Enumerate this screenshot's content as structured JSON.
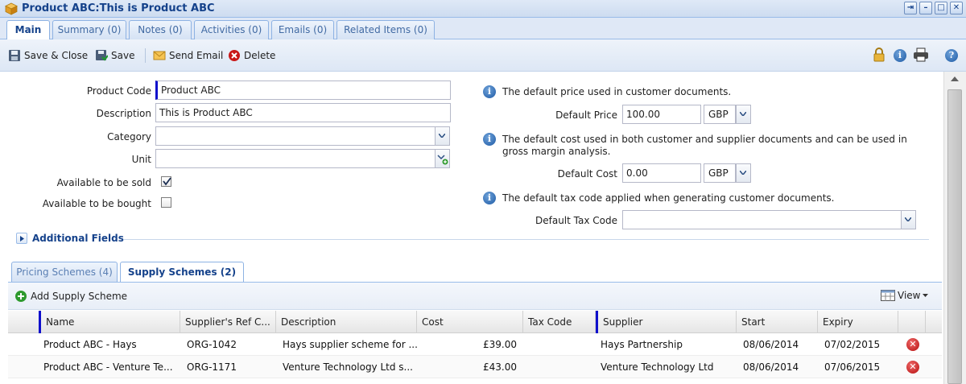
{
  "window": {
    "title": "Product ABC:This is Product ABC",
    "buttons": [
      "pin",
      "minimize",
      "maximize",
      "close"
    ]
  },
  "tabs": [
    {
      "label": "Main",
      "active": true
    },
    {
      "label": "Summary (0)",
      "active": false
    },
    {
      "label": "Notes (0)",
      "active": false
    },
    {
      "label": "Activities (0)",
      "active": false
    },
    {
      "label": "Emails (0)",
      "active": false
    },
    {
      "label": "Related Items (0)",
      "active": false
    }
  ],
  "toolbar": {
    "save_close": "Save & Close",
    "save": "Save",
    "send_email": "Send Email",
    "delete": "Delete",
    "right_icons": [
      "lock-icon",
      "info-icon",
      "print-icon",
      "help-icon"
    ]
  },
  "form": {
    "product_code": {
      "label": "Product Code",
      "value": "Product ABC"
    },
    "description": {
      "label": "Description",
      "value": "This is Product ABC"
    },
    "category": {
      "label": "Category",
      "value": ""
    },
    "unit": {
      "label": "Unit",
      "value": ""
    },
    "available_sold": {
      "label": "Available to be sold",
      "checked": true
    },
    "available_bought": {
      "label": "Available to be bought",
      "checked": false
    }
  },
  "pricing": {
    "price_note": "The default price used in customer documents.",
    "price_label": "Default Price",
    "price_value": "100.00",
    "price_currency": "GBP",
    "cost_note": "The default cost used in both customer and supplier documents and can be used in gross margin analysis.",
    "cost_label": "Default Cost",
    "cost_value": "0.00",
    "cost_currency": "GBP",
    "tax_note": "The default tax code applied when generating customer documents.",
    "tax_label": "Default Tax Code",
    "tax_value": ""
  },
  "additional_fields": "Additional Fields",
  "subtabs": [
    {
      "label": "Pricing Schemes (4)",
      "active": false
    },
    {
      "label": "Supply Schemes (2)",
      "active": true
    }
  ],
  "grid_toolbar": {
    "add": "Add Supply Scheme",
    "view": "View"
  },
  "grid": {
    "columns": [
      "Name",
      "Supplier's Ref C...",
      "Description",
      "Cost",
      "Tax Code",
      "Supplier",
      "Start",
      "Expiry"
    ],
    "rows": [
      {
        "name": "Product ABC - Hays",
        "ref": "ORG-1042",
        "description": "Hays supplier scheme for ...",
        "cost": "£39.00",
        "tax": "",
        "supplier": "Hays Partnership",
        "start": "08/06/2014",
        "expiry": "07/02/2015"
      },
      {
        "name": "Product ABC - Venture Te...",
        "ref": "ORG-1171",
        "description": "Venture Technology Ltd s...",
        "cost": "£43.00",
        "tax": "",
        "supplier": "Venture Technology Ltd",
        "start": "08/06/2014",
        "expiry": "07/06/2015"
      }
    ]
  },
  "colors": {
    "accent": "#15428b",
    "required_marker": "#1010cc",
    "header_bg": "#dfe8f6"
  }
}
